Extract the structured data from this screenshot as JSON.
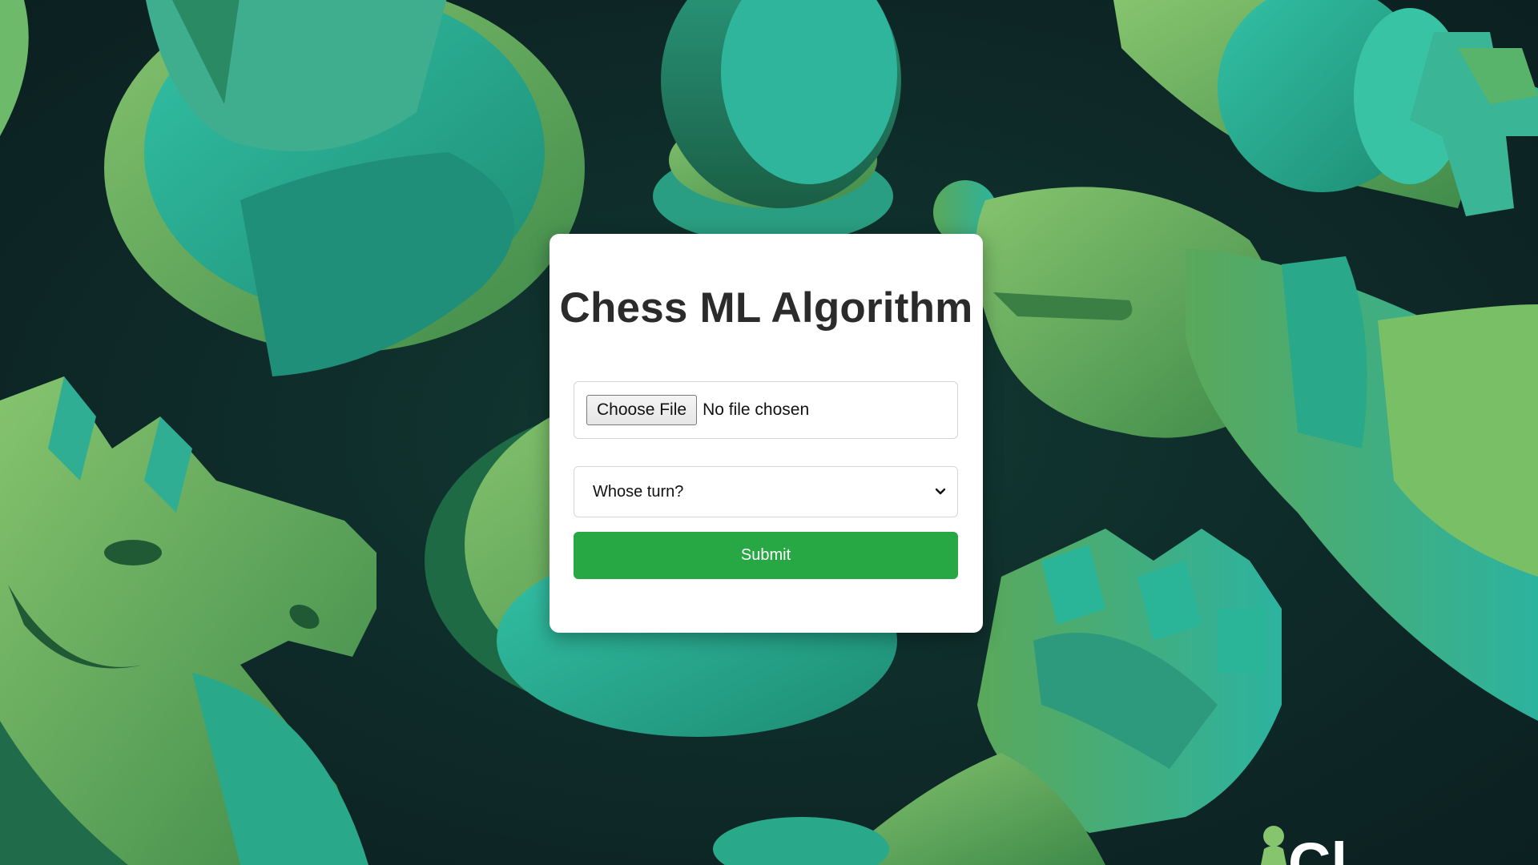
{
  "page": {
    "title": "Chess ML Algorithm"
  },
  "form": {
    "file_button_label": "Choose File",
    "file_status": "No file chosen",
    "turn_select_value": "Whose turn?",
    "submit_label": "Submit"
  },
  "background": {
    "description_icon": "chess-pieces-background",
    "dark_color": "#0e2a28",
    "piece_colors": [
      "#2bb39e",
      "#4f9a52",
      "#7ec06a",
      "#1e7a5a"
    ]
  },
  "corner_logo": {
    "text": "Cl",
    "icon": "pawn-icon"
  },
  "colors": {
    "accent": "#28a745",
    "card": "#ffffff",
    "title": "#2b2b2b"
  }
}
